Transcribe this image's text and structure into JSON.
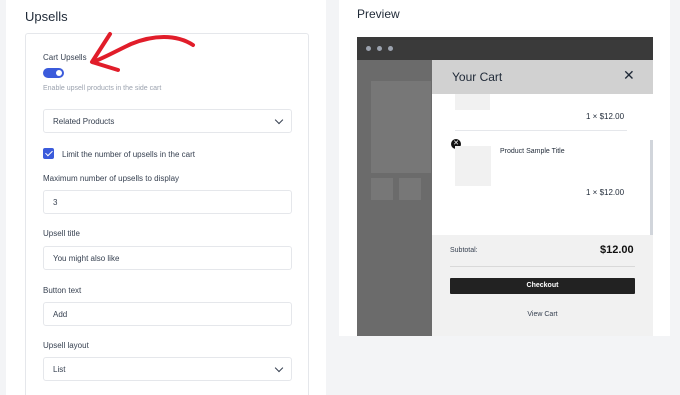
{
  "settings": {
    "section_title": "Upsells",
    "cart_upsells": {
      "label": "Cart Upsells",
      "enabled": true,
      "help": "Enable upsell products in the side cart"
    },
    "source_select": {
      "value": "Related Products"
    },
    "limit_checkbox": {
      "label": "Limit the number of upsells in the cart",
      "checked": true
    },
    "max_upsells": {
      "label": "Maximum number of upsells to display",
      "value": "3"
    },
    "upsell_title": {
      "label": "Upsell title",
      "value": "You might also like"
    },
    "button_text": {
      "label": "Button text",
      "value": "Add"
    },
    "upsell_layout": {
      "label": "Upsell layout",
      "value": "List"
    }
  },
  "preview": {
    "title": "Preview",
    "cart": {
      "title": "Your Cart",
      "close_icon": "close-icon",
      "items": [
        {
          "title": "",
          "price": "1 × $12.00"
        },
        {
          "title": "Product Sample Title",
          "price": "1 × $12.00"
        }
      ],
      "subtotal_label": "Subtotal:",
      "subtotal_value": "$12.00",
      "checkout_label": "Checkout",
      "view_cart_label": "View Cart"
    }
  },
  "colors": {
    "accent": "#3b5bdb",
    "annotation": "#e11d2a",
    "browser_bar": "#3a3a3a",
    "cart_header": "#d1d1d1"
  }
}
